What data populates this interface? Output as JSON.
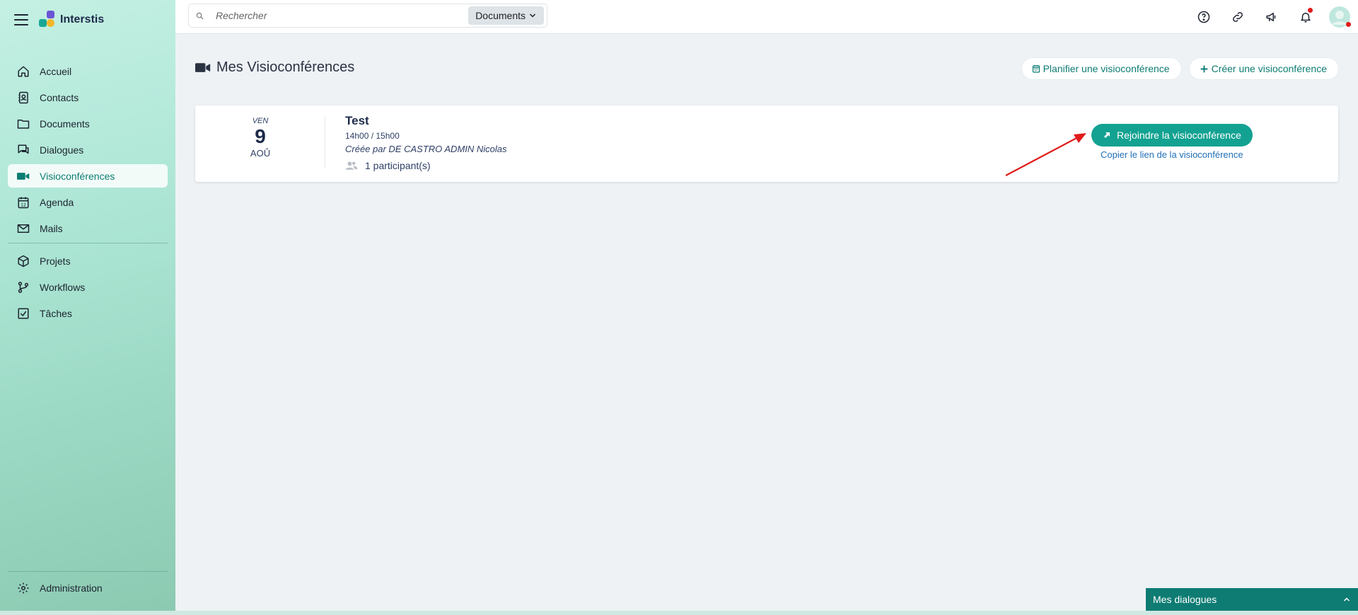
{
  "app": {
    "name": "Interstis"
  },
  "search": {
    "placeholder": "Rechercher",
    "scope": "Documents"
  },
  "sidebar": {
    "items": [
      {
        "label": "Accueil",
        "icon": "home-icon"
      },
      {
        "label": "Contacts",
        "icon": "contacts-icon"
      },
      {
        "label": "Documents",
        "icon": "folder-icon"
      },
      {
        "label": "Dialogues",
        "icon": "chat-icon"
      },
      {
        "label": "Visioconférences",
        "icon": "video-icon",
        "active": true
      },
      {
        "label": "Agenda",
        "icon": "calendar-icon"
      },
      {
        "label": "Mails",
        "icon": "mail-icon"
      },
      {
        "label": "Projets",
        "icon": "cube-icon"
      },
      {
        "label": "Workflows",
        "icon": "branch-icon"
      },
      {
        "label": "Tâches",
        "icon": "checkbox-icon"
      }
    ],
    "admin": {
      "label": "Administration",
      "icon": "gear-icon"
    }
  },
  "topbar": {
    "icons": [
      "help-icon",
      "link-icon",
      "megaphone-icon",
      "bell-icon",
      "avatar"
    ]
  },
  "page": {
    "title": "Mes Visioconférences",
    "plan_label": "Planifier une visioconférence",
    "create_label": "Créer une visioconférence"
  },
  "meeting": {
    "dow": "VEN",
    "day": "9",
    "month": "AOÛ",
    "title": "Test",
    "time": "14h00 / 15h00",
    "creator": "Créée par DE CASTRO ADMIN Nicolas",
    "participants": "1 participant(s)",
    "join_label": "Rejoindre la visioconférence",
    "copy_label": "Copier le lien de la visioconférence"
  },
  "dialogues_panel": {
    "label": "Mes dialogues"
  },
  "colors": {
    "accent": "#13a291",
    "accent_dark": "#0e7c73",
    "annotation": "#e01b1b"
  }
}
